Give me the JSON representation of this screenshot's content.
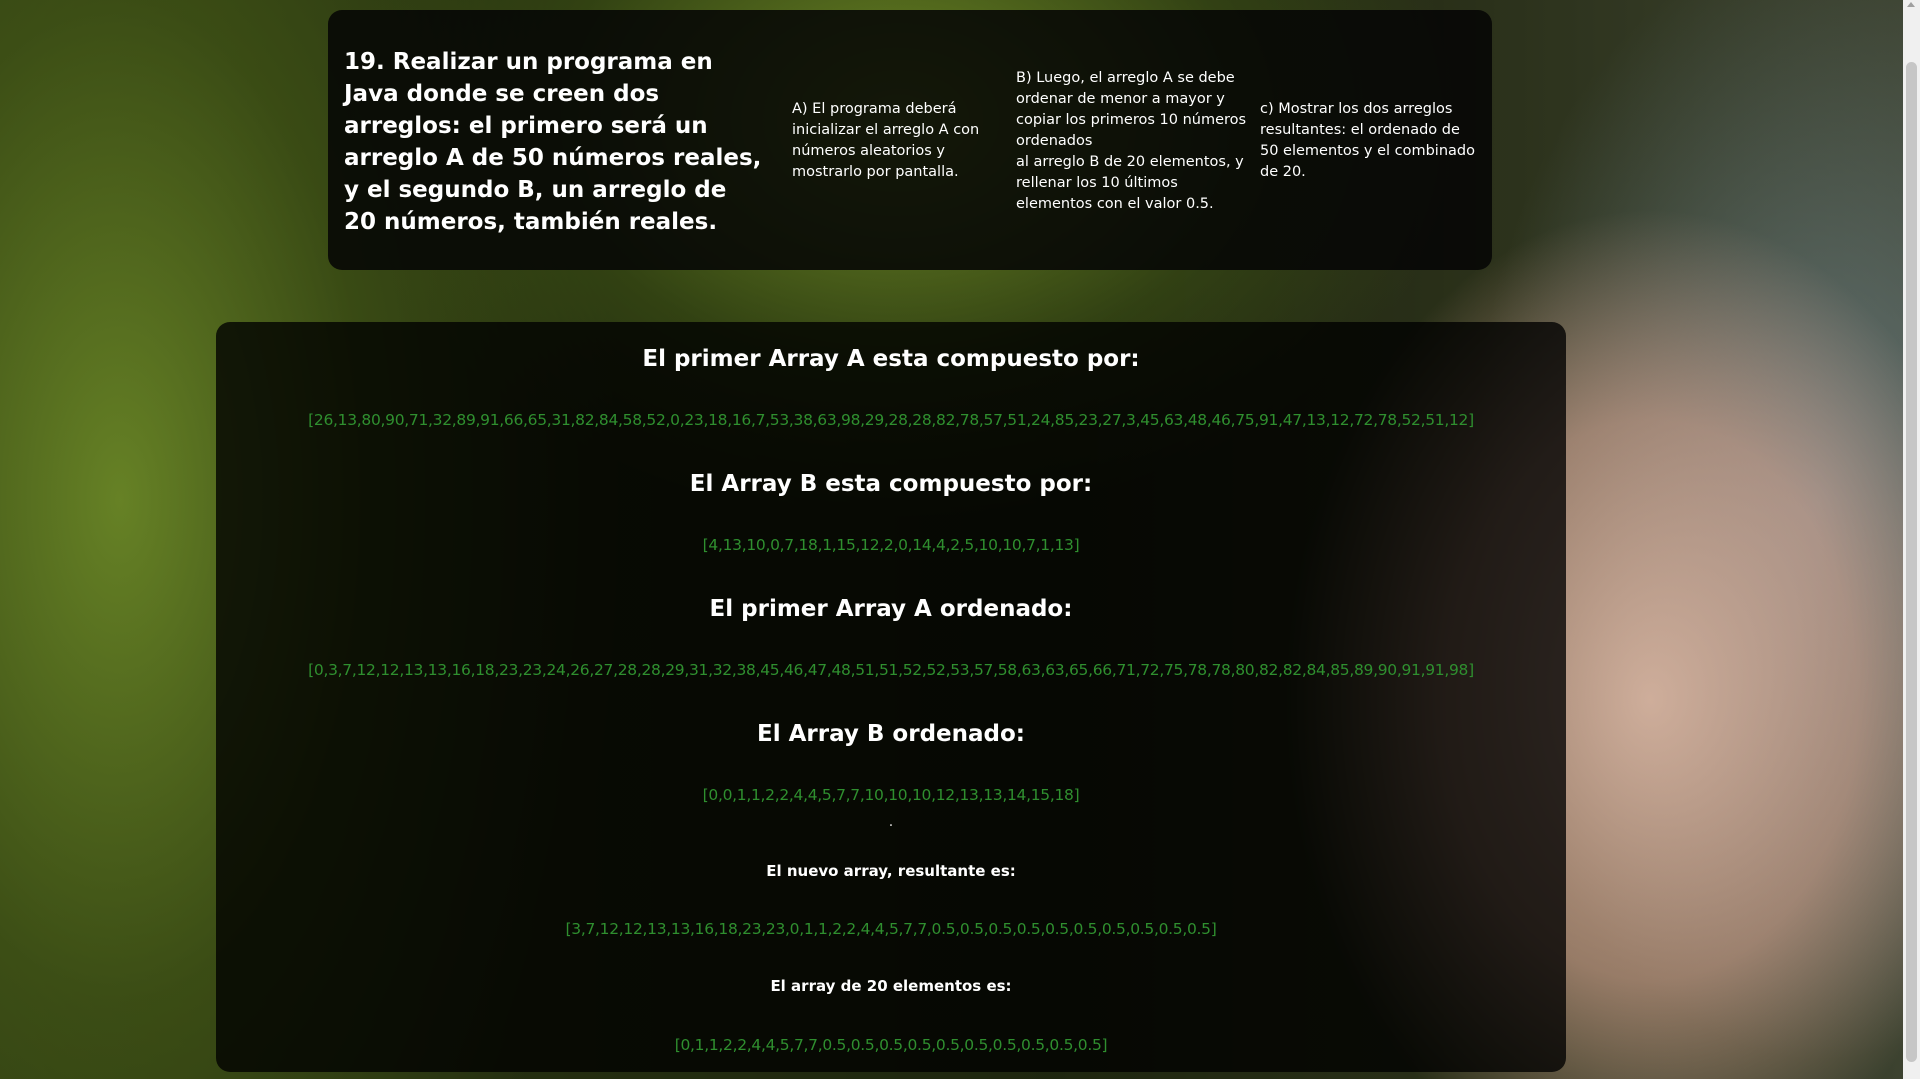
{
  "header": {
    "title": "19. Realizar un programa en Java donde se creen dos arreglos: el primero será un arreglo A de 50 números reales,\ny el segundo B, un arreglo de 20 números, también reales.",
    "col_a": "A) El programa deberá inicializar el arreglo A con números aleatorios y mostrarlo por pantalla.",
    "col_b": "B) Luego, el arreglo A se debe ordenar de menor a mayor y copiar los primeros 10 números ordenados\nal arreglo B de 20 elementos, y rellenar los 10 últimos elementos con el valor 0.5.",
    "col_c": "c) Mostrar los dos arreglos resultantes: el ordenado de 50 elementos y el combinado de 20."
  },
  "results": {
    "array_a_heading": "El primer Array A esta compuesto por:",
    "array_a_values": "[26,13,80,90,71,32,89,91,66,65,31,82,84,58,52,0,23,18,16,7,53,38,63,98,29,28,28,82,78,57,51,24,85,23,27,3,45,63,48,46,75,91,47,13,12,72,78,52,51,12]",
    "array_b_heading": "El Array B esta compuesto por:",
    "array_b_values": "[4,13,10,0,7,18,1,15,12,2,0,14,4,2,5,10,10,7,1,13]",
    "array_a_sorted_heading": "El primer Array A ordenado:",
    "array_a_sorted_values": "[0,3,7,12,12,13,13,16,18,23,23,24,26,27,28,28,29,31,32,38,45,46,47,48,51,51,52,52,53,57,58,63,63,65,66,71,72,75,78,78,80,82,82,84,85,89,90,91,91,98]",
    "array_b_sorted_heading": "El Array B ordenado:",
    "array_b_sorted_values": "[0,0,1,1,2,2,4,4,5,7,7,10,10,10,12,13,13,14,15,18]",
    "separator": ".",
    "new_array_heading": "El nuevo array, resultante es:",
    "new_array_values": "[3,7,12,12,13,13,16,18,23,23,0,1,1,2,2,4,4,5,7,7,0.5,0.5,0.5,0.5,0.5,0.5,0.5,0.5,0.5,0.5]",
    "array_20_heading": "El array de 20 elementos es:",
    "array_20_values": "[0,1,1,2,2,4,4,5,7,7,0.5,0.5,0.5,0.5,0.5,0.5,0.5,0.5,0.5,0.5]"
  },
  "colors": {
    "array_text": "#2f8f2f",
    "card_background": "#050505",
    "heading_text": "#ffffff"
  }
}
